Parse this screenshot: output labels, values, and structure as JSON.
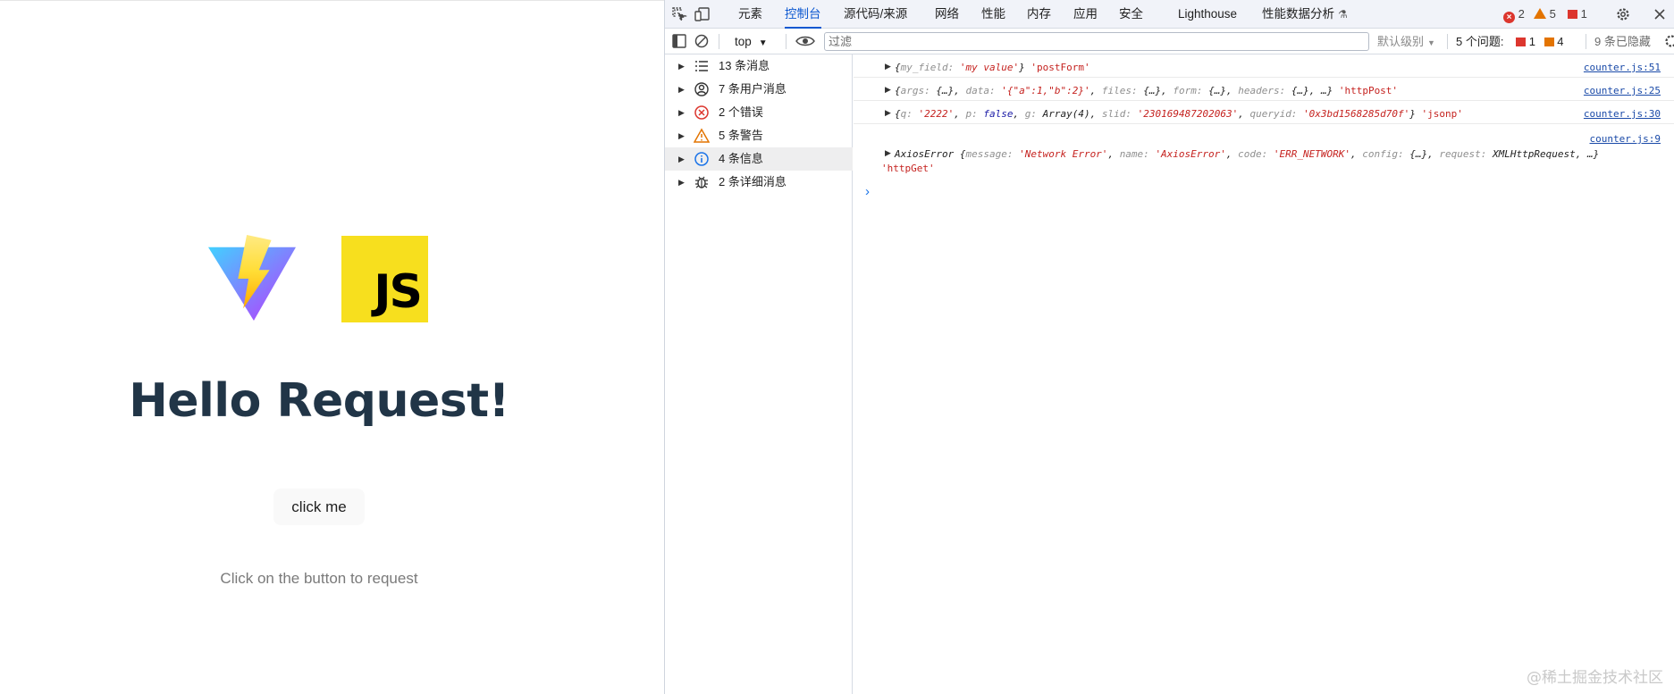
{
  "app": {
    "js_logo_text": "JS",
    "title": "Hello Request!",
    "button_label": "click me",
    "hint": "Click on the button to request"
  },
  "devtools": {
    "tabs": [
      {
        "label": "元素"
      },
      {
        "label": "控制台"
      },
      {
        "label": "源代码/来源"
      },
      {
        "label": "网络"
      },
      {
        "label": "性能"
      },
      {
        "label": "内存"
      },
      {
        "label": "应用"
      },
      {
        "label": "安全"
      },
      {
        "label": "Lighthouse"
      },
      {
        "label": "性能数据分析"
      }
    ],
    "counts": {
      "errors": "2",
      "warnings": "5",
      "issues": "1"
    },
    "filterbar": {
      "context": "top",
      "filter_placeholder": "过滤",
      "levels": "默认级别",
      "issues_label": "5 个问题:",
      "issues_red": "1",
      "issues_orange": "4",
      "hidden": "9 条已隐藏"
    },
    "sidebar": [
      {
        "label": "13 条消息"
      },
      {
        "label": "7 条用户消息"
      },
      {
        "label": "2 个错误"
      },
      {
        "label": "5 条警告"
      },
      {
        "label": "4 条信息"
      },
      {
        "label": "2 条详细消息"
      }
    ],
    "messages": {
      "m1": {
        "k1": "my_field:",
        "v1": "'my value'",
        "close": "}",
        "tag": "'postForm'",
        "src": "counter.js:51"
      },
      "m2": {
        "k1": "args:",
        "v1": "{…}",
        "k2": "data:",
        "v2": "'{\"a\":1,\"b\":2}'",
        "k3": "files:",
        "v3": "{…}",
        "k4": "form:",
        "v4": "{…}",
        "k5": "headers:",
        "v5": "{…}",
        "rest": "…}",
        "tag": "'httpPost'",
        "src": "counter.js:25"
      },
      "m3": {
        "k1": "q:",
        "v1": "'2222'",
        "k2": "p:",
        "v2": "false",
        "k3": "g:",
        "v3": "Array(4)",
        "k4": "slid:",
        "v4": "'230169487202063'",
        "k5": "queryid:",
        "v5": "'0x3bd1568285d70f'",
        "close": "}",
        "tag": "'jsonp'",
        "src": "counter.js:30"
      },
      "m4": {
        "name": "AxiosError",
        "k1": "message:",
        "v1": "'Network Error'",
        "k2": "name:",
        "v2": "'AxiosError'",
        "k3": "code:",
        "v3": "'ERR_NETWORK'",
        "k4": "config:",
        "v4": "{…}",
        "k5": "request:",
        "v5": "XMLHttpRequest",
        "rest": "…}",
        "tag": "'httpGet'",
        "src": "counter.js:9"
      }
    }
  },
  "watermark": "@稀土掘金技术社区"
}
